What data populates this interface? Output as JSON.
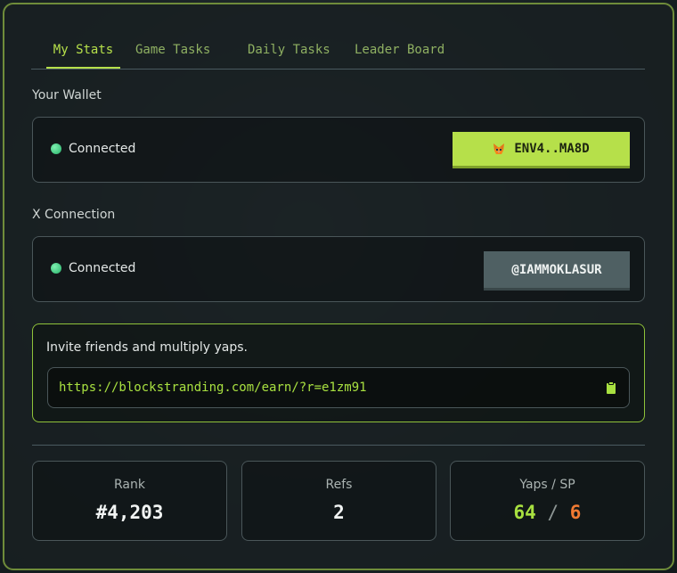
{
  "tabs": [
    {
      "label": "My Stats",
      "active": true
    },
    {
      "label": "Game Tasks",
      "active": false
    },
    {
      "label": "Daily Tasks",
      "active": false
    },
    {
      "label": "Leader Board",
      "active": false
    }
  ],
  "wallet": {
    "label": "Your Wallet",
    "status": "Connected",
    "address": "ENV4..MA8D",
    "icon": "metamask-fox-icon"
  },
  "x_connection": {
    "label": "X Connection",
    "status": "Connected",
    "handle": "@IAMMOKLASUR"
  },
  "invite": {
    "text": "Invite friends and multiply yaps.",
    "link": "https://blockstranding.com/earn/?r=e1zm91",
    "copy_icon": "clipboard-icon"
  },
  "stats": {
    "rank": {
      "label": "Rank",
      "value": "#4,203"
    },
    "refs": {
      "label": "Refs",
      "value": "2"
    },
    "yaps_sp": {
      "label": "Yaps / SP",
      "yaps": "64",
      "separator": "/",
      "sp": "6"
    }
  },
  "colors": {
    "accent": "#b6e04a",
    "sp": "#f07a32",
    "connected": "#3ed38a"
  }
}
